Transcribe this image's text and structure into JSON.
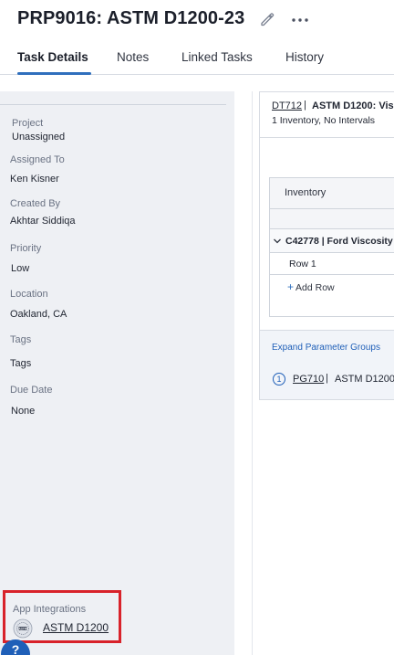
{
  "header": {
    "title": "PRP9016: ASTM D1200-23",
    "edit_icon": "pencil-icon",
    "more_icon": "more-horizontal-icon"
  },
  "tabs": [
    {
      "label": "Task Details",
      "active": true
    },
    {
      "label": "Notes",
      "active": false
    },
    {
      "label": "Linked Tasks",
      "active": false
    },
    {
      "label": "History",
      "active": false
    }
  ],
  "sidebar": {
    "project": {
      "label": "Project",
      "value": "Unassigned"
    },
    "assigned_to": {
      "label": "Assigned To",
      "value": "Ken Kisner"
    },
    "created_by": {
      "label": "Created By",
      "value": "Akhtar Siddiqa"
    },
    "priority": {
      "label": "Priority",
      "value": "Low"
    },
    "location": {
      "label": "Location",
      "value": "Oakland, CA"
    },
    "tags": {
      "label": "Tags",
      "value": "Tags"
    },
    "due_date": {
      "label": "Due Date",
      "value": "None"
    },
    "app_integrations": {
      "label": "App Integrations",
      "link": "ASTM D1200",
      "logo_icon": "astm-logo-icon"
    }
  },
  "help": {
    "label": "?"
  },
  "card": {
    "link": "DT712",
    "separator": "|",
    "title": "ASTM D1200: Vis",
    "subtitle": "1 Inventory, No Intervals",
    "grid": {
      "header": "Inventory",
      "group": "C42778 | Ford Viscosity",
      "row": "Row 1",
      "add_row": "Add Row"
    },
    "expand_link": "Expand Parameter Groups",
    "parameter_group": {
      "number": "1",
      "link": "PG710",
      "separator": "|",
      "title": "ASTM D1200"
    }
  },
  "colors": {
    "accent": "#2f6fbd",
    "highlight_border": "#d8222a",
    "sidebar_bg": "#eef0f4",
    "help_bg": "#1f5fb8"
  }
}
